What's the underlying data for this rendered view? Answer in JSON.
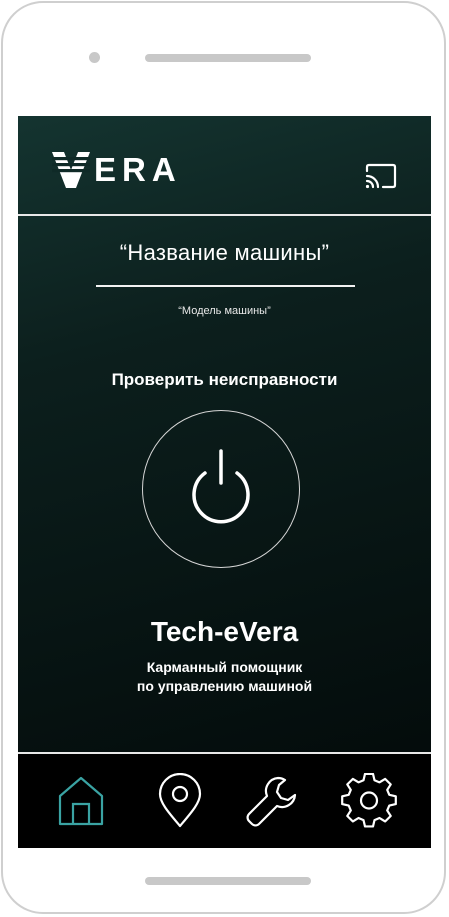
{
  "app": {
    "logo_text": "ERA",
    "car_name": "“Название машины”",
    "car_model": "“Модель машины”",
    "check_faults_label": "Проверить неисправности",
    "title": "Tech-eVera",
    "subtitle_line1": "Карманный помощник",
    "subtitle_line2": "по управлению машиной"
  },
  "icons": {
    "cast": "cast-icon",
    "power": "power-icon",
    "logo": "vera-v-logo-icon"
  },
  "tabbar": {
    "active_index": 0,
    "items": [
      {
        "icon": "home-icon"
      },
      {
        "icon": "location-pin-icon"
      },
      {
        "icon": "wrench-icon"
      },
      {
        "icon": "gear-icon"
      }
    ]
  },
  "colors": {
    "accent": "#3aa3a3",
    "background_top": "#143430",
    "background_bottom": "#030808",
    "text": "#ffffff"
  }
}
